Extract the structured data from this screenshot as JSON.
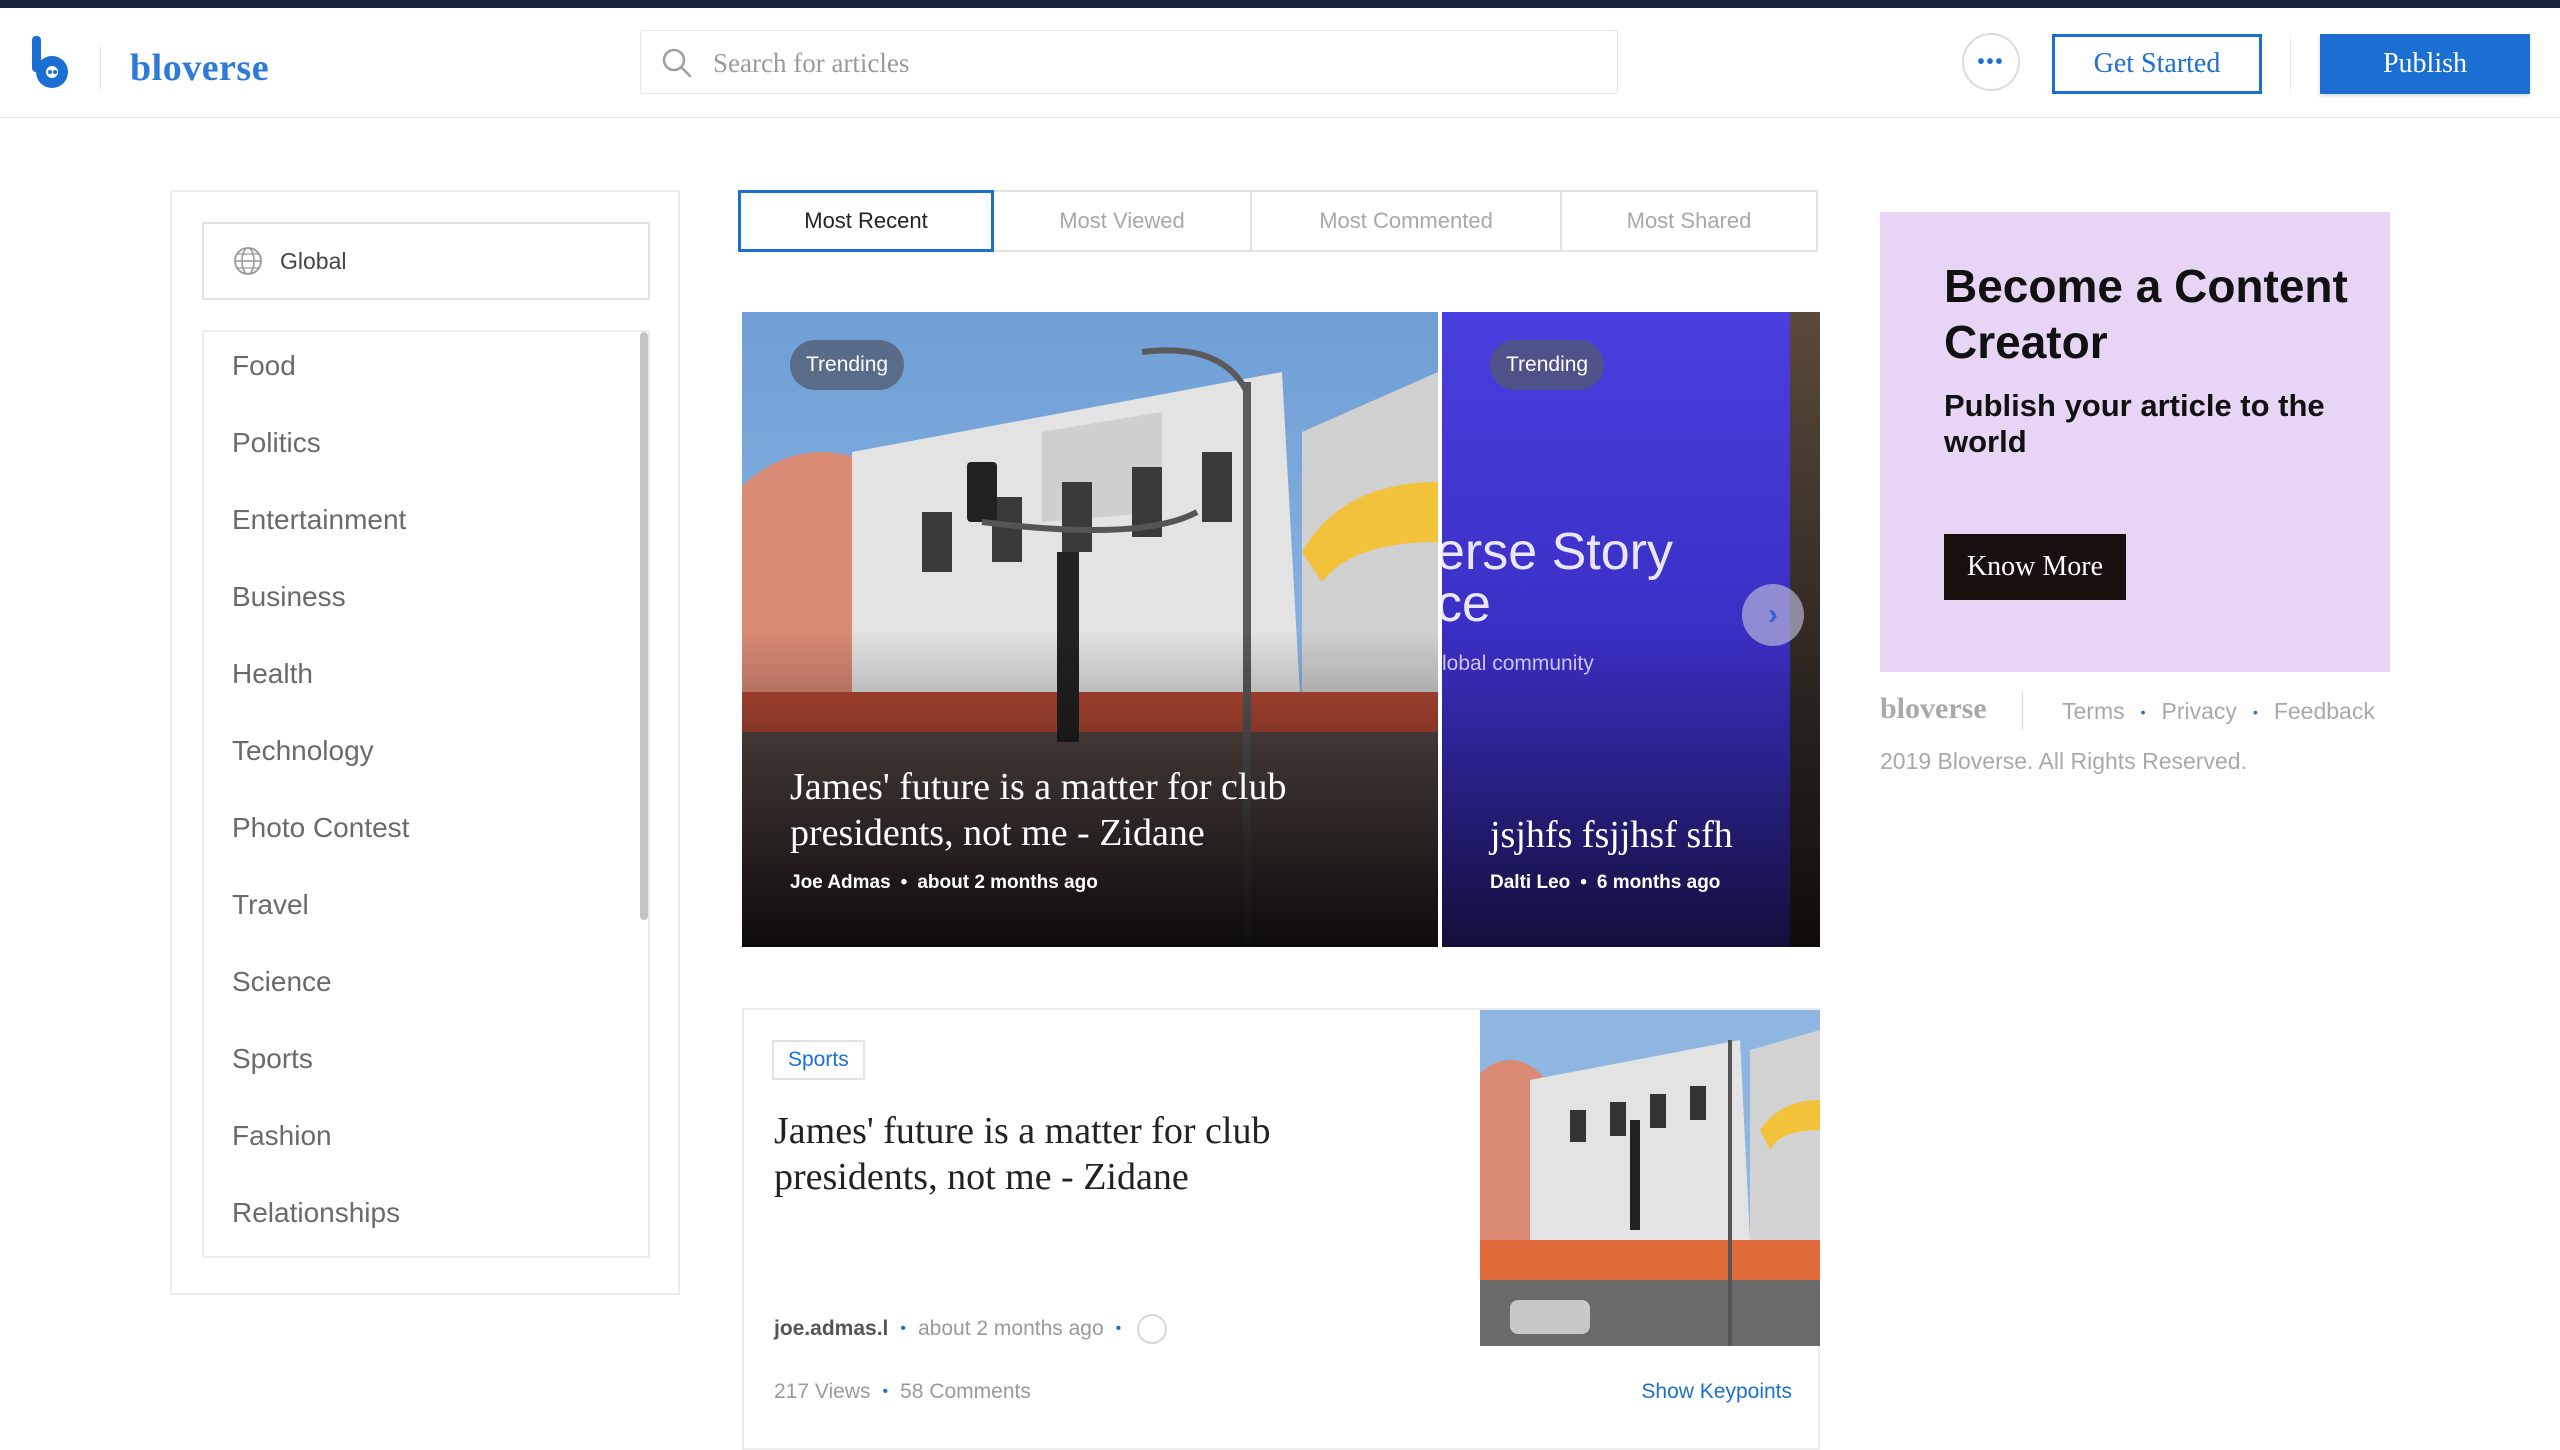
{
  "app": {
    "brand": "bloverse",
    "accent": "#1b6fd2",
    "topbar_color": "#18243a"
  },
  "header": {
    "search": {
      "placeholder": "Search for articles",
      "value": ""
    },
    "more_label": "•••",
    "get_started": "Get Started",
    "publish": "Publish"
  },
  "sidebar": {
    "region": "Global",
    "categories": [
      "Food",
      "Politics",
      "Entertainment",
      "Business",
      "Health",
      "Technology",
      "Photo Contest",
      "Travel",
      "Science",
      "Sports",
      "Fashion",
      "Relationships"
    ]
  },
  "tabs": [
    "Most Recent",
    "Most Viewed",
    "Most Commented",
    "Most Shared"
  ],
  "carousel": {
    "slides": [
      {
        "badge": "Trending",
        "title": "James' future is a matter for club presidents, not me - Zidane",
        "author": "Joe Admas",
        "time": "about 2 months ago"
      },
      {
        "badge": "Trending",
        "title": "jsjhfs fsjjhsf sfh",
        "author": "Dalti Leo",
        "time": "6 months ago",
        "overlay_line1": "erse Story",
        "overlay_line2": "ce",
        "overlay_sub": "lobal community"
      }
    ],
    "next_icon": "chevron-right-icon"
  },
  "article": {
    "tag": "Sports",
    "title": "James' future is a matter for club presidents, not me - Zidane",
    "author": "joe.admas.l",
    "time": "about 2 months ago",
    "views": "217 Views",
    "comments": "58 Comments",
    "keypoints": "Show Keypoints"
  },
  "promo": {
    "title": "Become a Content Creator",
    "subtitle": "Publish your article to the world",
    "button": "Know More",
    "bg_color": "#e8d5f5"
  },
  "footer": {
    "brand": "bloverse",
    "links": [
      "Terms",
      "Privacy",
      "Feedback"
    ],
    "copyright": "2019 Bloverse. All Rights Reserved."
  }
}
